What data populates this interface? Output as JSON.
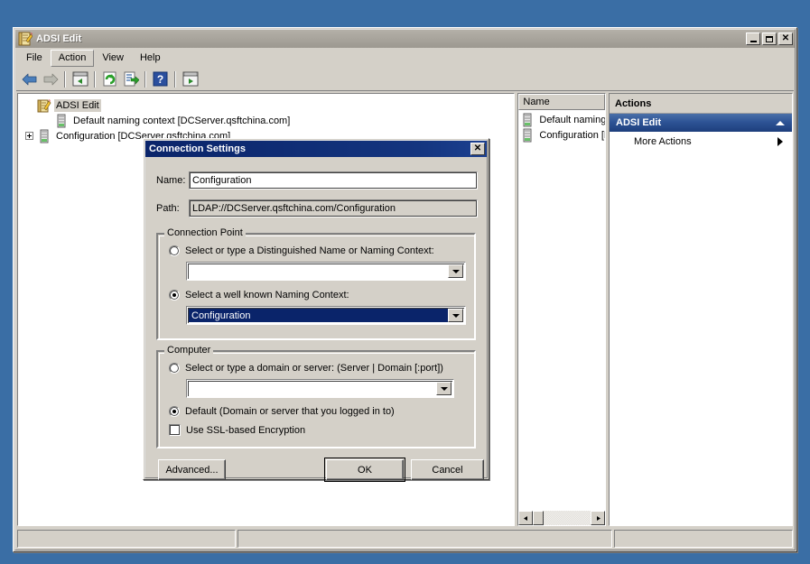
{
  "desktop": {
    "background": "#3a6ea5"
  },
  "window": {
    "title": "ADSI Edit",
    "icon": "adsi-edit-icon",
    "controls": {
      "minimize": "_",
      "maximize": "□",
      "close": "✕"
    },
    "menu": [
      {
        "label": "File",
        "hover": false
      },
      {
        "label": "Action",
        "hover": true
      },
      {
        "label": "View",
        "hover": false
      },
      {
        "label": "Help",
        "hover": false
      }
    ],
    "toolbar": [
      {
        "name": "back-icon",
        "type": "icon"
      },
      {
        "name": "forward-icon",
        "type": "icon"
      },
      {
        "name": "separator",
        "type": "sep"
      },
      {
        "name": "show-hide-console-tree-icon",
        "type": "icon"
      },
      {
        "name": "separator",
        "type": "sep"
      },
      {
        "name": "refresh-icon",
        "type": "icon"
      },
      {
        "name": "export-list-icon",
        "type": "icon"
      },
      {
        "name": "separator",
        "type": "sep"
      },
      {
        "name": "help-icon",
        "type": "icon"
      },
      {
        "name": "separator",
        "type": "sep"
      },
      {
        "name": "show-hide-action-pane-icon",
        "type": "icon"
      }
    ]
  },
  "tree": {
    "root": {
      "label": "ADSI Edit",
      "icon": "adsi-edit-icon",
      "selected": true,
      "expander": null
    },
    "children": [
      {
        "label": "Default naming context [DCServer.qsftchina.com]",
        "icon": "naming-context-icon",
        "expander": null
      },
      {
        "label": "Configuration [DCServer.qsftchina.com]",
        "icon": "naming-context-icon",
        "expander": "plus"
      }
    ]
  },
  "list_pane": {
    "column_header": "Name",
    "rows": [
      {
        "label": "Default naming",
        "icon": "naming-context-icon"
      },
      {
        "label": "Configuration [D",
        "icon": "naming-context-icon"
      }
    ],
    "scrollbar": {
      "left_arrow": "◄",
      "right_arrow": "►"
    }
  },
  "actions_pane": {
    "title": "Actions",
    "group": {
      "label": "ADSI Edit",
      "collapse_icon": "chevron-up-icon"
    },
    "items": [
      {
        "label": "More Actions",
        "submenu_icon": "chevron-right-icon"
      }
    ]
  },
  "statusbar": {
    "cells": [
      "",
      "",
      ""
    ]
  },
  "dialog": {
    "title": "Connection Settings",
    "close_label": "✕",
    "fields": {
      "name_label": "Name:",
      "name_value": "Configuration",
      "path_label": "Path:",
      "path_value": "LDAP://DCServer.qsftchina.com/Configuration"
    },
    "connection_point": {
      "legend": "Connection Point",
      "option_dn": {
        "label": "Select or type a Distinguished Name or Naming Context:",
        "checked": false,
        "combo_value": ""
      },
      "option_wellknown": {
        "label": "Select a well known Naming Context:",
        "checked": true,
        "combo_value": "Configuration",
        "combo_selected": true
      }
    },
    "computer": {
      "legend": "Computer",
      "option_server": {
        "label": "Select or type a domain or server: (Server | Domain [:port])",
        "checked": false,
        "combo_value": ""
      },
      "option_default": {
        "label": "Default (Domain or server that you logged in to)",
        "checked": true
      },
      "ssl_checkbox": {
        "label": "Use SSL-based Encryption",
        "checked": false
      }
    },
    "buttons": {
      "advanced": "Advanced...",
      "ok": "OK",
      "cancel": "Cancel"
    }
  },
  "colors": {
    "desktop": "#3a6ea5",
    "chrome": "#d4d0c8",
    "dialog_title": "#0a246a",
    "actions_group": "#2e5496",
    "selection": "#0a246a"
  }
}
